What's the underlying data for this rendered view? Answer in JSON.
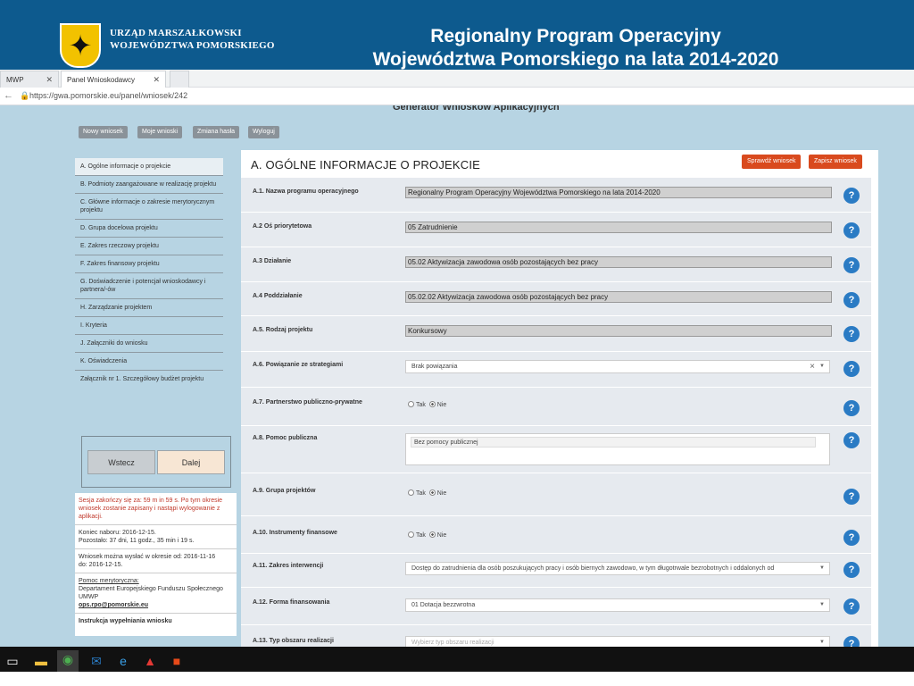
{
  "banner": {
    "org_line1": "URZĄD MARSZAŁKOWSKI",
    "org_line2": "WOJEWÓDZTWA POMORSKIEGO",
    "title_line1": "Regionalny Program Operacyjny",
    "title_line2": "Województwa Pomorskiego na lata 2014-2020"
  },
  "browser": {
    "tab1": "MWP",
    "tab2": "Panel Wnioskodawcy",
    "url": "https://gwa.pomorskie.eu/panel/wniosek/242"
  },
  "page": {
    "generator_title": "Generator Wniosków Aplikacyjnych",
    "top_buttons": [
      "Nowy wniosek",
      "Moje wnioski",
      "Zmiana hasła",
      "Wyloguj"
    ],
    "sidebar": [
      "A. Ogólne informacje o projekcie",
      "B. Podmioty zaangażowane w realizację projektu",
      "C. Główne informacje o zakresie merytorycznym projektu",
      "D. Grupa docelowa projektu",
      "E. Zakres rzeczowy projektu",
      "F. Zakres finansowy projektu",
      "G. Doświadczenie i potencjał wnioskodawcy i partnera/-ów",
      "H. Zarządzanie projektem",
      "I. Kryteria",
      "J. Załączniki do wniosku",
      "K. Oświadczenia",
      "Załącznik nr 1. Szczegółowy budżet projektu"
    ],
    "nav": {
      "back": "Wstecz",
      "next": "Dalej"
    },
    "info": {
      "session": "Sesja zakończy się za: 59 m in 59 s. Po tym okresie wniosek zostanie zapisany i nastąpi wylogowanie z aplikacji.",
      "end_line1": "Koniec naboru: 2016-12-15.",
      "end_line2": "Pozostało: 37 dni, 11 godz., 35 min i 19 s.",
      "send_line1": "Wniosek można wysłać w okresie od: 2016-11-16",
      "send_line2": "do: 2016-12-15.",
      "help_title": "Pomoc merytoryczna:",
      "help_dept": "Departament Europejskiego Funduszu Społecznego UMWP",
      "help_email": "ops.rpo@pomorskie.eu",
      "instruction": "Instrukcja wypełniania wniosku"
    }
  },
  "form": {
    "title": "A. OGÓLNE INFORMACJE O PROJEKCIE",
    "check_button": "Sprawdź wniosek",
    "save_button": "Zapisz wniosek",
    "help_glyph": "?",
    "radio_yes": "Tak",
    "radio_no": "Nie",
    "rows": {
      "a1_label": "A.1. Nazwa programu operacyjnego",
      "a1_value": "Regionalny Program Operacyjny Województwa Pomorskiego na lata 2014-2020",
      "a2_label": "A.2 Oś priorytetowa",
      "a2_value": "05 Zatrudnienie",
      "a3_label": "A.3 Działanie",
      "a3_value": "05.02 Aktywizacja zawodowa osób pozostających bez pracy",
      "a4_label": "A.4 Poddziałanie",
      "a4_value": "05.02.02 Aktywizacja zawodowa osób pozostających bez pracy",
      "a5_label": "A.5. Rodzaj projektu",
      "a5_value": "Konkursowy",
      "a6_label": "A.6. Powiązanie ze strategiami",
      "a6_value": "Brak powiązania",
      "a7_label": "A.7. Partnerstwo publiczno-prywatne",
      "a8_label": "A.8. Pomoc publiczna",
      "a8_value": "Bez pomocy publicznej",
      "a9_label": "A.9. Grupa projektów",
      "a10_label": "A.10. Instrumenty finansowe",
      "a11_label": "A.11. Zakres interwencji",
      "a11_value": "Dostęp do zatrudnienia dla osób poszukujących pracy i osób biernych zawodowo, w tym długotrwale bezrobotnych i oddalonych od",
      "a12_label": "A.12. Forma finansowania",
      "a12_value": "01 Dotacja bezzwrotna",
      "a13_label": "A.13. Typ obszaru realizacji",
      "a13_placeholder": "Wybierz typ obszaru realizacji"
    }
  }
}
